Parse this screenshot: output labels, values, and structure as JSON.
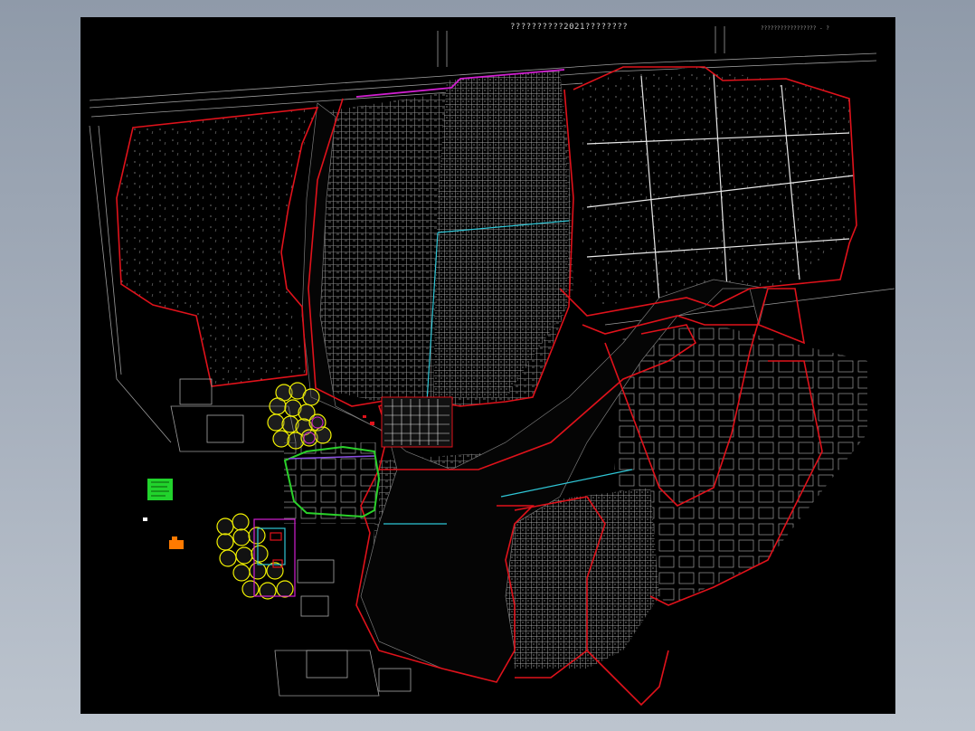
{
  "drawing": {
    "title": "??????????2021????????",
    "corner_note": "????????????????? - ?"
  },
  "colors": {
    "background": "#000000",
    "boundary": "#e0121b",
    "road": "#ffffff",
    "parcel": "#8c8c8c",
    "magenta": "#d21fd2",
    "cyan": "#2fc6d6",
    "green": "#2bd12b",
    "yellow": "#f3f300",
    "orange": "#ff7a00"
  },
  "legend": {
    "green_block_icon": "legend-green-block",
    "orange_block_icon": "legend-orange-block"
  }
}
